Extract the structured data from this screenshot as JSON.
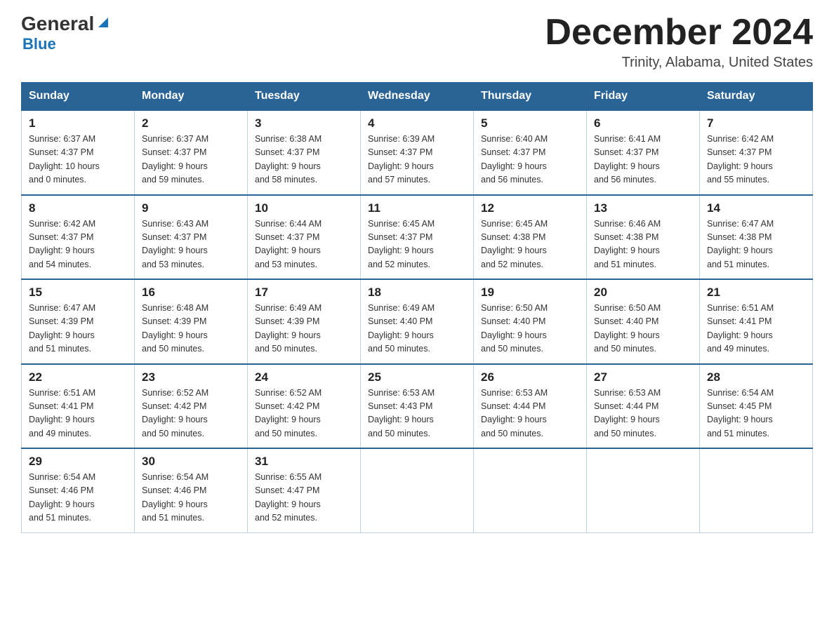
{
  "logo": {
    "general": "General",
    "blue": "Blue"
  },
  "title": "December 2024",
  "location": "Trinity, Alabama, United States",
  "days_of_week": [
    "Sunday",
    "Monday",
    "Tuesday",
    "Wednesday",
    "Thursday",
    "Friday",
    "Saturday"
  ],
  "weeks": [
    [
      {
        "day": "1",
        "sunrise": "6:37 AM",
        "sunset": "4:37 PM",
        "daylight": "10 hours and 0 minutes."
      },
      {
        "day": "2",
        "sunrise": "6:37 AM",
        "sunset": "4:37 PM",
        "daylight": "9 hours and 59 minutes."
      },
      {
        "day": "3",
        "sunrise": "6:38 AM",
        "sunset": "4:37 PM",
        "daylight": "9 hours and 58 minutes."
      },
      {
        "day": "4",
        "sunrise": "6:39 AM",
        "sunset": "4:37 PM",
        "daylight": "9 hours and 57 minutes."
      },
      {
        "day": "5",
        "sunrise": "6:40 AM",
        "sunset": "4:37 PM",
        "daylight": "9 hours and 56 minutes."
      },
      {
        "day": "6",
        "sunrise": "6:41 AM",
        "sunset": "4:37 PM",
        "daylight": "9 hours and 56 minutes."
      },
      {
        "day": "7",
        "sunrise": "6:42 AM",
        "sunset": "4:37 PM",
        "daylight": "9 hours and 55 minutes."
      }
    ],
    [
      {
        "day": "8",
        "sunrise": "6:42 AM",
        "sunset": "4:37 PM",
        "daylight": "9 hours and 54 minutes."
      },
      {
        "day": "9",
        "sunrise": "6:43 AM",
        "sunset": "4:37 PM",
        "daylight": "9 hours and 53 minutes."
      },
      {
        "day": "10",
        "sunrise": "6:44 AM",
        "sunset": "4:37 PM",
        "daylight": "9 hours and 53 minutes."
      },
      {
        "day": "11",
        "sunrise": "6:45 AM",
        "sunset": "4:37 PM",
        "daylight": "9 hours and 52 minutes."
      },
      {
        "day": "12",
        "sunrise": "6:45 AM",
        "sunset": "4:38 PM",
        "daylight": "9 hours and 52 minutes."
      },
      {
        "day": "13",
        "sunrise": "6:46 AM",
        "sunset": "4:38 PM",
        "daylight": "9 hours and 51 minutes."
      },
      {
        "day": "14",
        "sunrise": "6:47 AM",
        "sunset": "4:38 PM",
        "daylight": "9 hours and 51 minutes."
      }
    ],
    [
      {
        "day": "15",
        "sunrise": "6:47 AM",
        "sunset": "4:39 PM",
        "daylight": "9 hours and 51 minutes."
      },
      {
        "day": "16",
        "sunrise": "6:48 AM",
        "sunset": "4:39 PM",
        "daylight": "9 hours and 50 minutes."
      },
      {
        "day": "17",
        "sunrise": "6:49 AM",
        "sunset": "4:39 PM",
        "daylight": "9 hours and 50 minutes."
      },
      {
        "day": "18",
        "sunrise": "6:49 AM",
        "sunset": "4:40 PM",
        "daylight": "9 hours and 50 minutes."
      },
      {
        "day": "19",
        "sunrise": "6:50 AM",
        "sunset": "4:40 PM",
        "daylight": "9 hours and 50 minutes."
      },
      {
        "day": "20",
        "sunrise": "6:50 AM",
        "sunset": "4:40 PM",
        "daylight": "9 hours and 50 minutes."
      },
      {
        "day": "21",
        "sunrise": "6:51 AM",
        "sunset": "4:41 PM",
        "daylight": "9 hours and 49 minutes."
      }
    ],
    [
      {
        "day": "22",
        "sunrise": "6:51 AM",
        "sunset": "4:41 PM",
        "daylight": "9 hours and 49 minutes."
      },
      {
        "day": "23",
        "sunrise": "6:52 AM",
        "sunset": "4:42 PM",
        "daylight": "9 hours and 50 minutes."
      },
      {
        "day": "24",
        "sunrise": "6:52 AM",
        "sunset": "4:42 PM",
        "daylight": "9 hours and 50 minutes."
      },
      {
        "day": "25",
        "sunrise": "6:53 AM",
        "sunset": "4:43 PM",
        "daylight": "9 hours and 50 minutes."
      },
      {
        "day": "26",
        "sunrise": "6:53 AM",
        "sunset": "4:44 PM",
        "daylight": "9 hours and 50 minutes."
      },
      {
        "day": "27",
        "sunrise": "6:53 AM",
        "sunset": "4:44 PM",
        "daylight": "9 hours and 50 minutes."
      },
      {
        "day": "28",
        "sunrise": "6:54 AM",
        "sunset": "4:45 PM",
        "daylight": "9 hours and 51 minutes."
      }
    ],
    [
      {
        "day": "29",
        "sunrise": "6:54 AM",
        "sunset": "4:46 PM",
        "daylight": "9 hours and 51 minutes."
      },
      {
        "day": "30",
        "sunrise": "6:54 AM",
        "sunset": "4:46 PM",
        "daylight": "9 hours and 51 minutes."
      },
      {
        "day": "31",
        "sunrise": "6:55 AM",
        "sunset": "4:47 PM",
        "daylight": "9 hours and 52 minutes."
      },
      null,
      null,
      null,
      null
    ]
  ],
  "labels": {
    "sunrise": "Sunrise:",
    "sunset": "Sunset:",
    "daylight": "Daylight:"
  }
}
